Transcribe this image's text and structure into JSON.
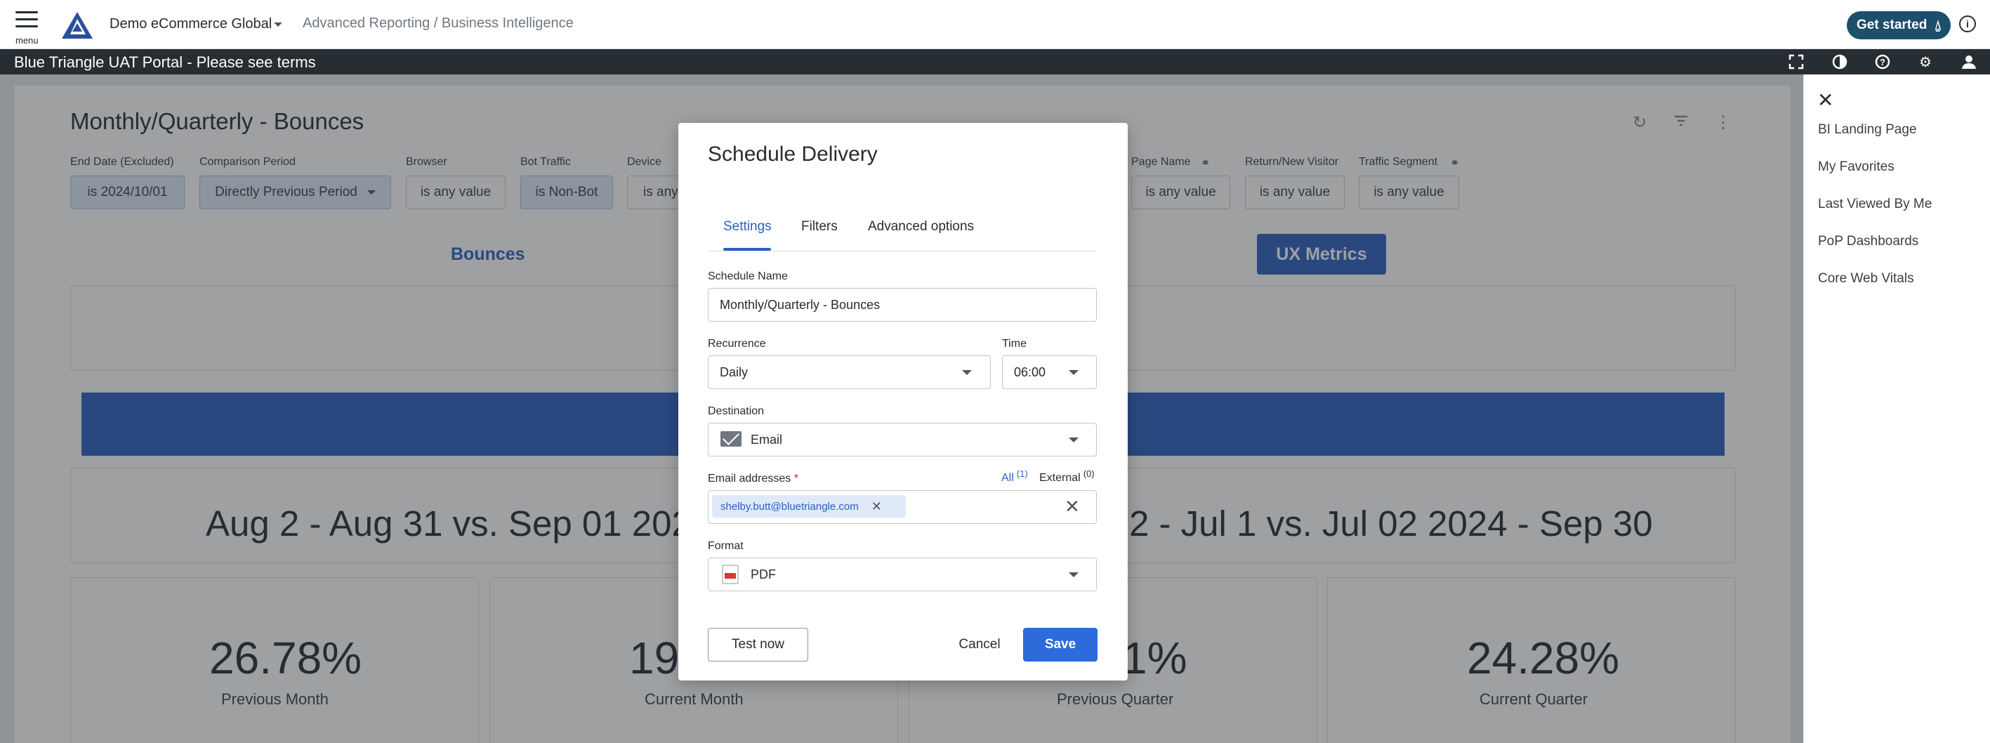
{
  "topbar": {
    "menu_label": "menu",
    "account": "Demo eCommerce Global",
    "breadcrumb": "Advanced Reporting / Business Intelligence",
    "get_started": "Get started",
    "info_icon": "info-icon"
  },
  "banner": {
    "text": "Blue Triangle UAT Portal - Please see terms",
    "icons": [
      "fullscreen-icon",
      "contrast-icon",
      "help-icon",
      "settings-icon",
      "user-icon"
    ]
  },
  "dashboard": {
    "title": "Monthly/Quarterly - Bounces",
    "filters": [
      {
        "label": "End Date (Excluded)",
        "value": "is 2024/10/01"
      },
      {
        "label": "Comparison Period",
        "value": "Directly Previous Period"
      },
      {
        "label": "Browser",
        "value": "is any value"
      },
      {
        "label": "Bot Traffic",
        "value": "is Non-Bot"
      },
      {
        "label": "Device",
        "value": "is any"
      },
      {
        "label": "Page Name",
        "value": "is any value"
      },
      {
        "label": "Return/New Visitor",
        "value": "is any value"
      },
      {
        "label": "Traffic Segment",
        "value": "is any value"
      }
    ],
    "tabs": {
      "bounces": "Bounces",
      "ux": "UX Metrics"
    },
    "period_left": "Aug 2 - Aug 31 vs. Sep 01 2024 - S",
    "period_right": "2 - Jul 1 vs. Jul 02 2024 - Sep 30",
    "kpis": [
      {
        "value": "26.78%",
        "label": "Previous Month"
      },
      {
        "value": "19.",
        "label": "Current Month"
      },
      {
        "value": "1%",
        "label": "Previous Quarter"
      },
      {
        "value": "24.28%",
        "label": "Current Quarter"
      }
    ]
  },
  "sidebar": {
    "items": [
      "BI Landing Page",
      "My Favorites",
      "Last Viewed By Me",
      "PoP Dashboards",
      "Core Web Vitals"
    ]
  },
  "modal": {
    "title": "Schedule Delivery",
    "tabs": [
      "Settings",
      "Filters",
      "Advanced options"
    ],
    "schedule_name_label": "Schedule Name",
    "schedule_name_value": "Monthly/Quarterly - Bounces",
    "recurrence_label": "Recurrence",
    "recurrence_value": "Daily",
    "time_label": "Time",
    "time_value": "06:00",
    "destination_label": "Destination",
    "destination_value": "Email",
    "email_label": "Email addresses",
    "email_required": "*",
    "email_all": "All",
    "email_all_count": "(1)",
    "email_external": "External",
    "email_external_count": "(0)",
    "email_chip": "shelby.butt@bluetriangle.com",
    "format_label": "Format",
    "format_value": "PDF",
    "test_now": "Test now",
    "cancel": "Cancel",
    "save": "Save"
  },
  "colors": {
    "accent": "#2c5fc2",
    "save_button": "#2c6bd9",
    "banner": "#262d33",
    "get_started": "#1d4e6b"
  }
}
